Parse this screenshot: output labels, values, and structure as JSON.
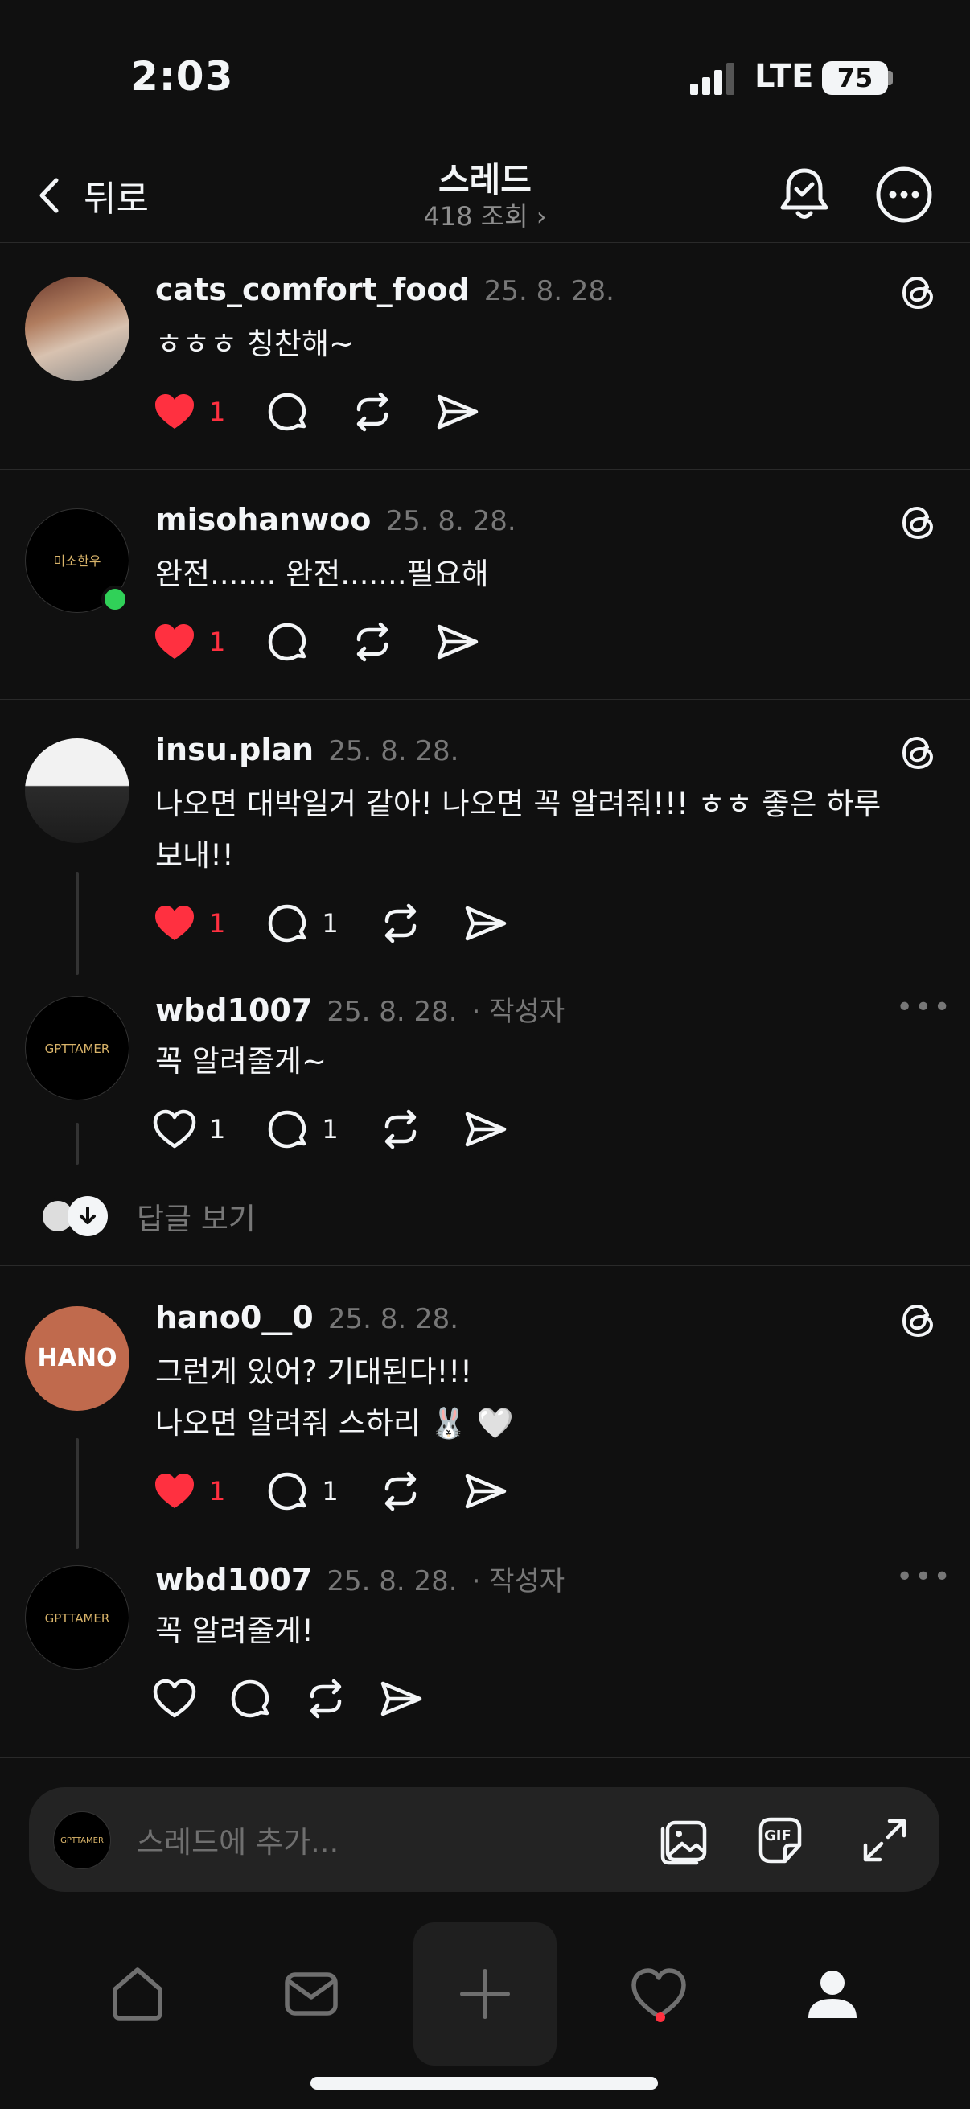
{
  "status_bar": {
    "time": "2:03",
    "network": "LTE",
    "battery": "75"
  },
  "header": {
    "back_label": "뒤로",
    "title": "스레드",
    "views": "418 조회 ›"
  },
  "posts": [
    {
      "username": "cats_comfort_food",
      "date": "25. 8. 28.",
      "text": "ㅎㅎㅎ 칭찬해~",
      "likes": "1",
      "liked": true
    },
    {
      "username": "misohanwoo",
      "date": "25. 8. 28.",
      "text": "완전....... 완전.......필요해",
      "likes": "1",
      "liked": true,
      "avatar_text": "미소한우"
    },
    {
      "username": "insu.plan",
      "date": "25. 8. 28.",
      "text": "나오면 대박일거 같아! 나오면 꼭 알려줘!!! ㅎㅎ 좋은 하루 보내!!",
      "likes": "1",
      "comments": "1",
      "liked": true
    },
    {
      "username": "wbd1007",
      "date": "25. 8. 28.",
      "author_tag": "· 작성자",
      "text": "꼭 알려줄게~",
      "likes": "1",
      "comments": "1",
      "liked": false,
      "avatar_text": "GPTTAMER"
    },
    {
      "username": "hano0__0",
      "date": "25. 8. 28.",
      "text_line1": "그런게 있어? 기대된다!!!",
      "text_line2": "나오면 알려줘 스하리 🐰 🤍",
      "likes": "1",
      "comments": "1",
      "liked": true,
      "avatar_text": "HANO"
    },
    {
      "username": "wbd1007",
      "date": "25. 8. 28.",
      "author_tag": "· 작성자",
      "text": "꼭 알려줄게!",
      "liked": false,
      "avatar_text": "GPTTAMER"
    }
  ],
  "view_replies": "답글 보기",
  "more_dots": "•••",
  "compose": {
    "placeholder": "스레드에 추가...",
    "avatar_text": "GPTTAMER",
    "gif_label": "GIF"
  },
  "colors": {
    "background": "#101010",
    "like_red": "#ff3040",
    "secondary_text": "#777777"
  }
}
